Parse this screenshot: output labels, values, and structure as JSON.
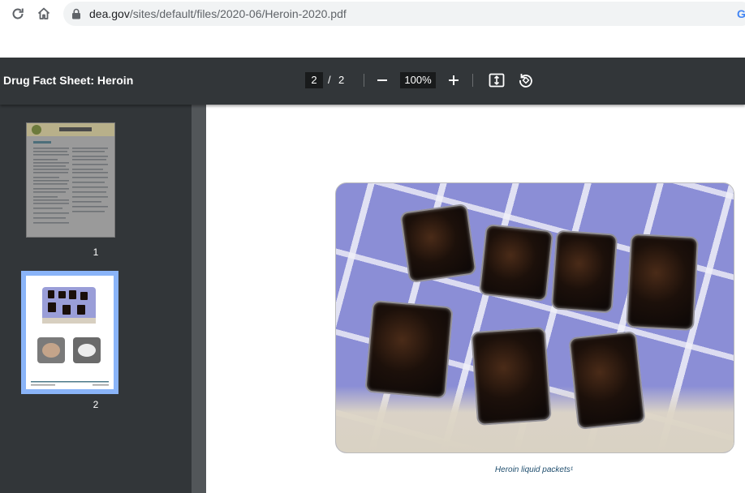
{
  "browser": {
    "url_domain": "dea.gov",
    "url_path": "/sites/default/files/2020-06/Heroin-2020.pdf",
    "google_icon": "G",
    "icons": [
      "reload-icon",
      "home-icon",
      "lock-icon"
    ]
  },
  "viewer": {
    "title": "Drug Fact Sheet: Heroin",
    "current_page": "2",
    "page_separator": "/",
    "total_pages": "2",
    "zoom": "100%",
    "icons": [
      "zoom-out-icon",
      "zoom-in-icon",
      "fit-page-icon",
      "rotate-icon"
    ]
  },
  "thumbnails": [
    {
      "label": "1"
    },
    {
      "label": "2"
    }
  ],
  "page": {
    "caption": "Heroin liquid packets¹"
  }
}
